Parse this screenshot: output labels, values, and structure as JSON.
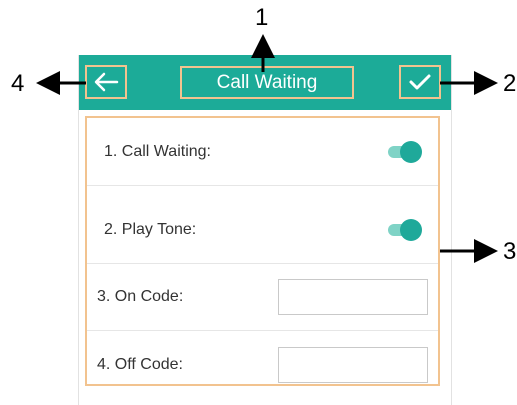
{
  "header": {
    "title": "Call Waiting",
    "back_icon": "arrow-left-icon",
    "confirm_icon": "check-icon",
    "bar_color": "#1cab98"
  },
  "settings": [
    {
      "label": "1. Call Waiting:",
      "type": "toggle",
      "on": true
    },
    {
      "label": "2. Play Tone:",
      "type": "toggle",
      "on": true
    },
    {
      "label": "3. On Code:",
      "type": "input",
      "value": ""
    },
    {
      "label": "4. Off Code:",
      "type": "input",
      "value": ""
    }
  ],
  "callouts": {
    "one": "1",
    "two": "2",
    "three": "3",
    "four": "4",
    "highlight_color": "#f2c38f"
  }
}
